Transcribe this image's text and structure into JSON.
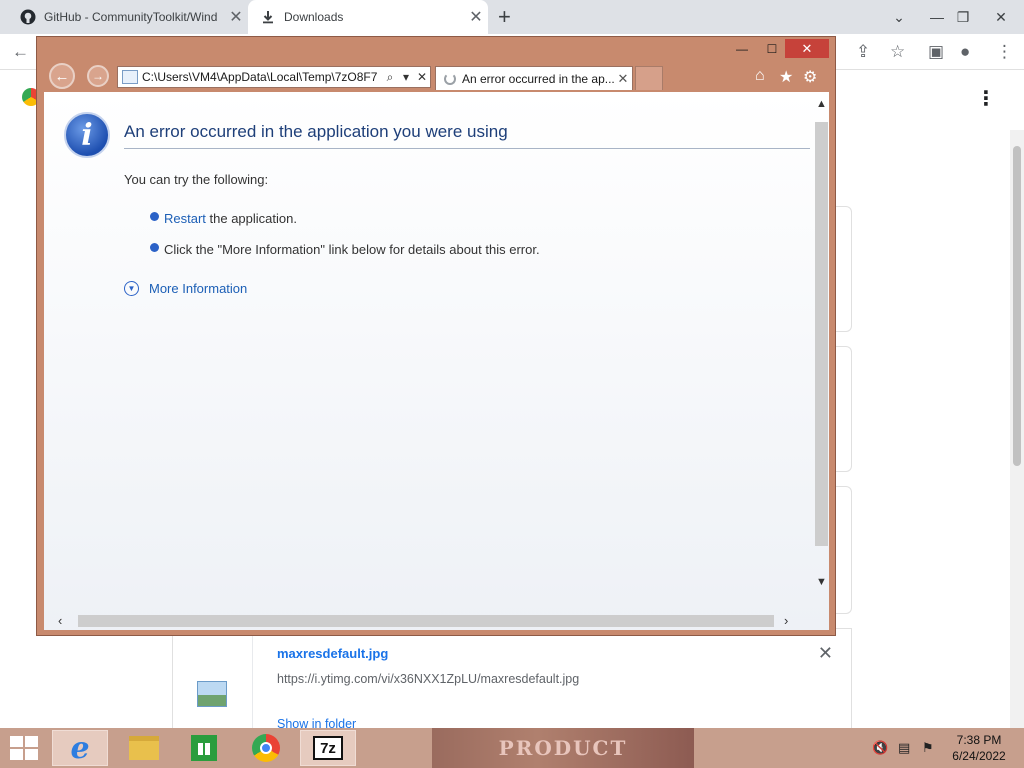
{
  "chrome": {
    "tabs": [
      {
        "label": "GitHub - CommunityToolkit/Wind",
        "icon": "github-icon"
      },
      {
        "label": "Downloads",
        "icon": "download-icon"
      }
    ],
    "new_tab": "+",
    "window_controls": {
      "minimize": "⌄",
      "restore": "—",
      "maximize": "❐",
      "close": "✕"
    },
    "menu": "⋮",
    "download_item": {
      "file_name": "maxresdefault.jpg",
      "url": "https://i.ytimg.com/vi/x36NXX1ZpLU/maxresdefault.jpg",
      "show_in_folder": "Show in folder",
      "close": "✕"
    }
  },
  "ie": {
    "address": "C:\\Users\\VM4\\AppData\\Local\\Temp\\7zO8F7",
    "tab_title": "An error occurred in the ap...",
    "tab_close": "✕",
    "window_controls": {
      "minimize": "—",
      "maximize": "☐",
      "close": "✕"
    },
    "back": "←",
    "forward": "→"
  },
  "error_page": {
    "title": "An error occurred in the application you were using",
    "subtitle": "You can try the following:",
    "items": [
      {
        "link": "Restart",
        "text": " the application."
      },
      {
        "text": "Click the \"More Information\" link below for details about this error."
      }
    ],
    "more_info": "More Information",
    "icon_glyph": "i"
  },
  "taskbar": {
    "seven_zip": "7z",
    "thumbnail_text": "PRODUCT",
    "clock_time": "7:38 PM",
    "clock_date": "6/24/2022"
  },
  "colors": {
    "ie_frame": "#c88a6e",
    "ie_close": "#c6423a",
    "link": "#1c5fb6",
    "title": "#1e3f79"
  }
}
